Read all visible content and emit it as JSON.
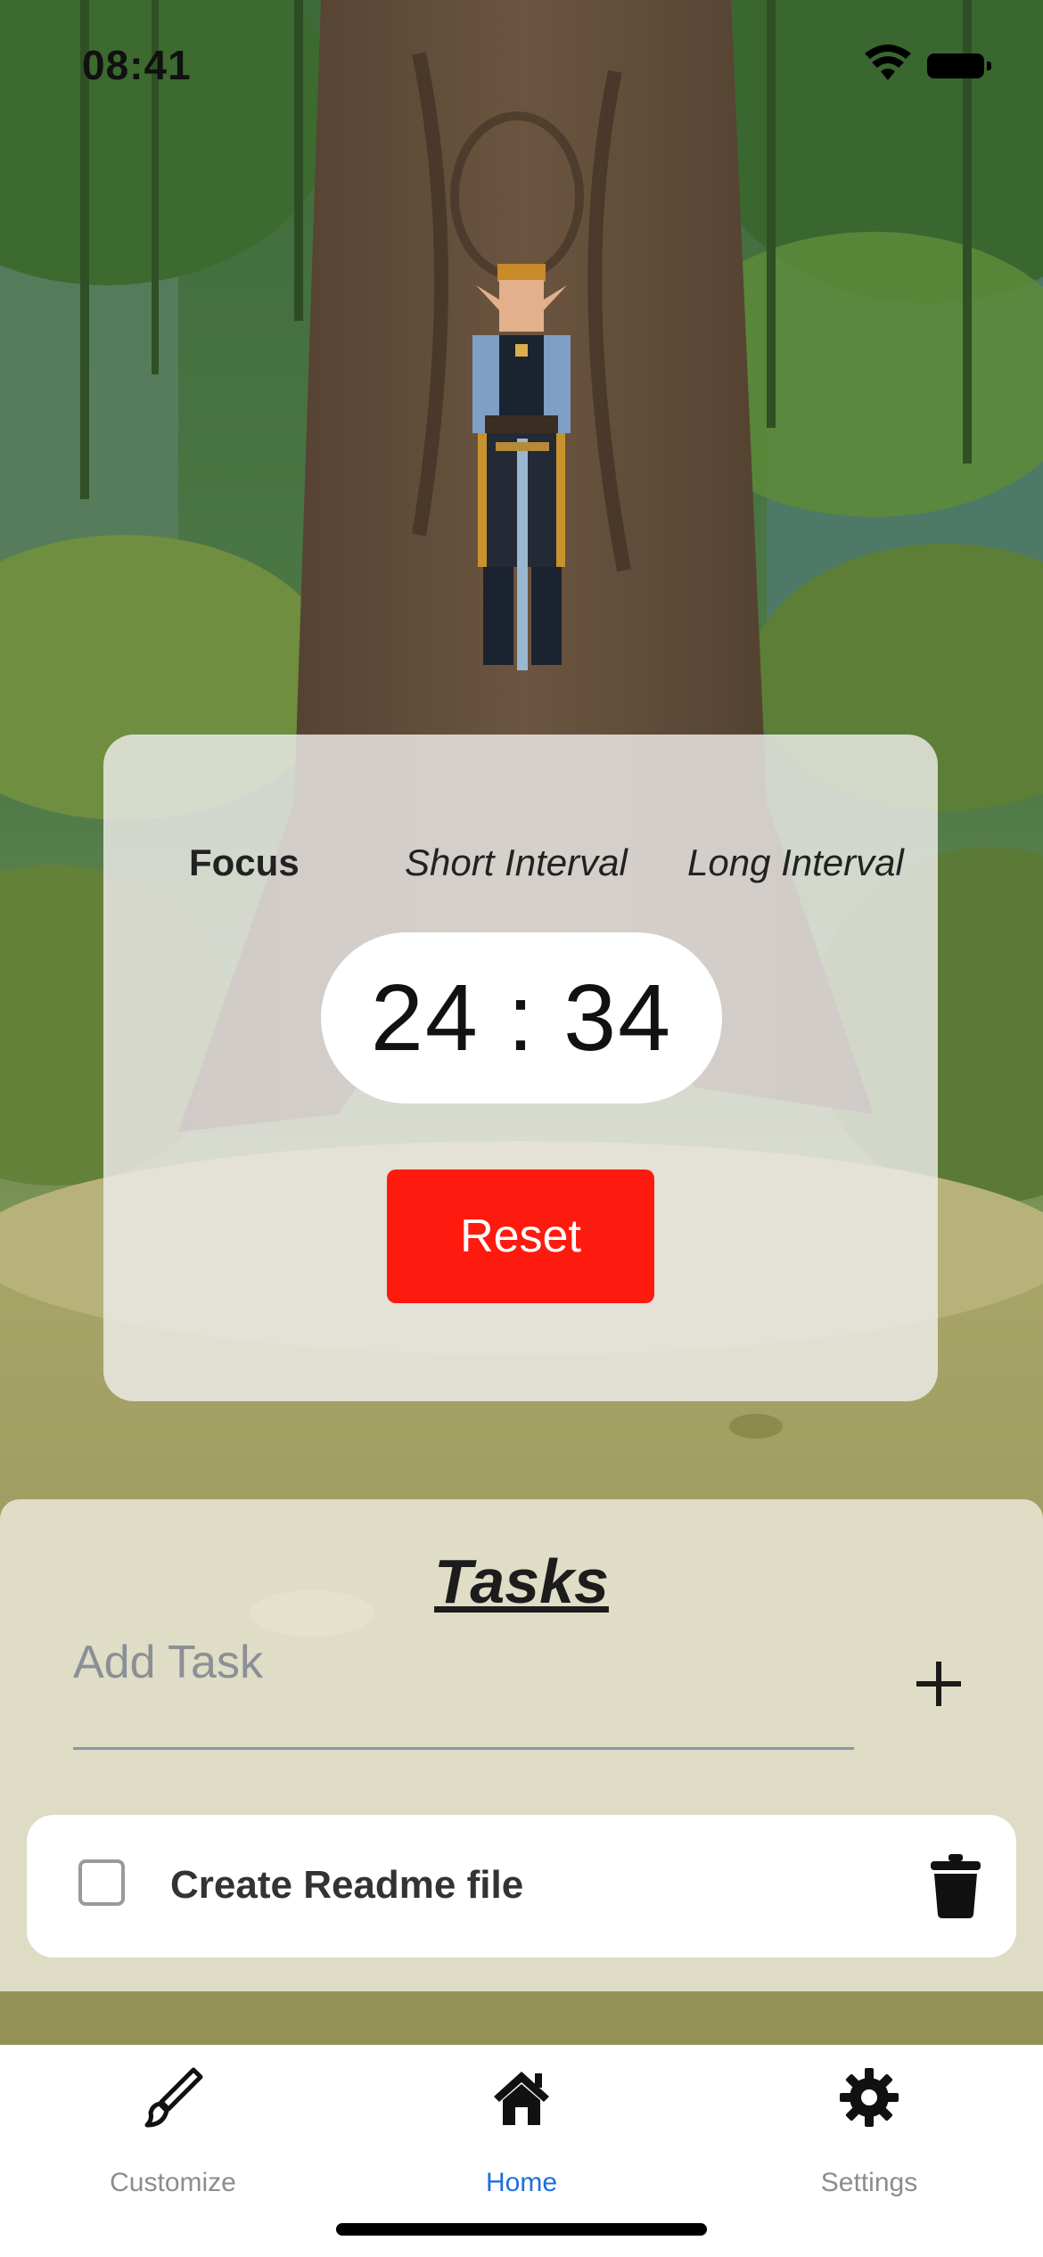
{
  "status_bar": {
    "time": "08:41",
    "icons": [
      "wifi-icon",
      "battery-icon"
    ]
  },
  "timer": {
    "modes": [
      {
        "label": "Focus",
        "selected": true
      },
      {
        "label": "Short Interval",
        "selected": false
      },
      {
        "label": "Long Interval",
        "selected": false
      }
    ],
    "display": "24 : 34",
    "reset_label": "Reset",
    "reset_color": "#ff1a0f"
  },
  "tasks": {
    "title": "Tasks",
    "input": {
      "placeholder": "Add Task",
      "value": ""
    },
    "add_icon": "plus-icon",
    "items": [
      {
        "label": "Create Readme file",
        "checked": false,
        "delete_icon": "trash-icon"
      }
    ]
  },
  "tab_bar": {
    "items": [
      {
        "label": "Customize",
        "icon": "paintbrush-icon",
        "active": false
      },
      {
        "label": "Home",
        "icon": "house-icon",
        "active": true
      },
      {
        "label": "Settings",
        "icon": "gear-icon",
        "active": false
      }
    ],
    "active_color": "#1c6fde",
    "inactive_color": "#8c8c90"
  }
}
